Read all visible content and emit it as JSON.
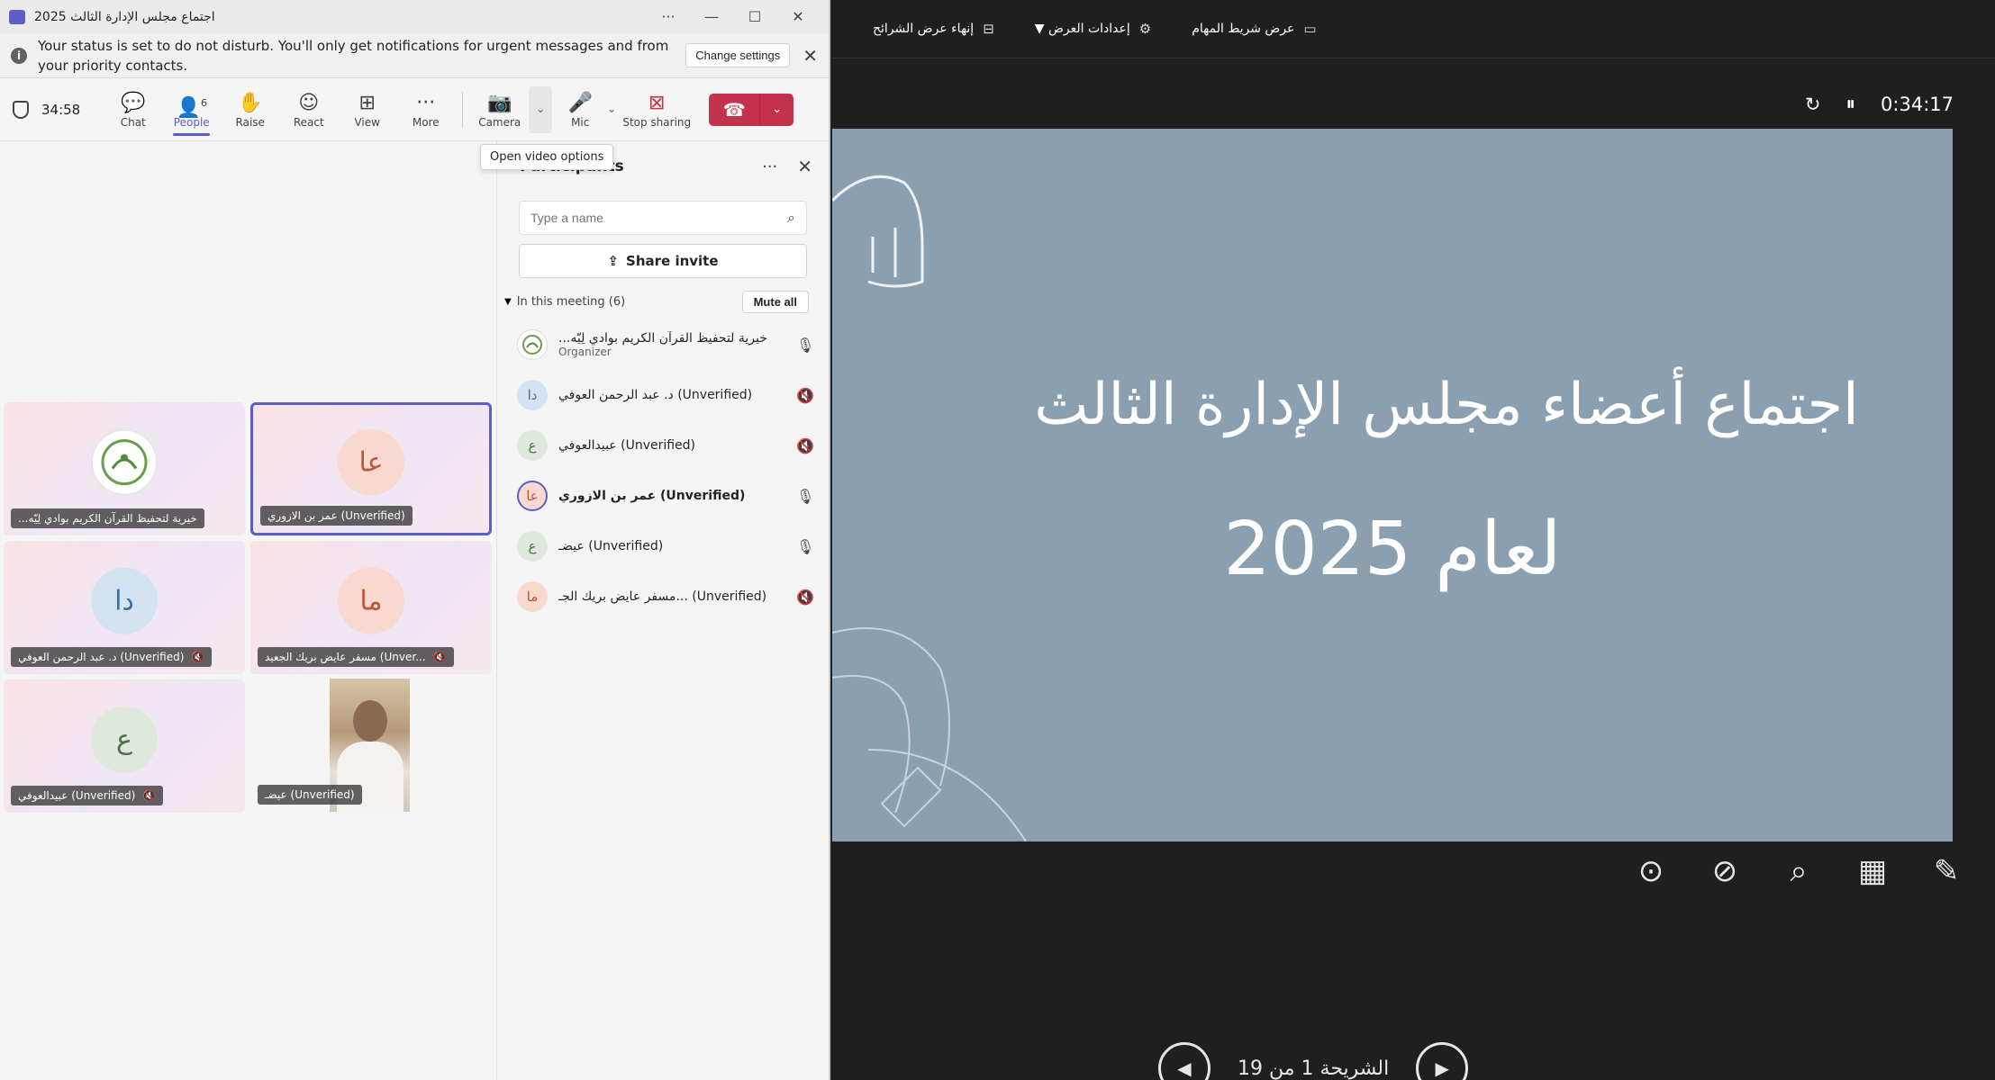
{
  "teams": {
    "title": "اجتماع مجلس الإدارة الثالث 2025",
    "window_controls": [
      "···",
      "—",
      "☐",
      "✕"
    ],
    "dnd": {
      "message": "Your status is set to do not disturb. You'll only get notifications for urgent messages and from your priority contacts.",
      "change_settings": "Change settings"
    },
    "toolbar": {
      "timer": "34:58",
      "chat": "Chat",
      "people": "People",
      "people_count": "6",
      "raise": "Raise",
      "react": "React",
      "view": "View",
      "more": "More",
      "camera": "Camera",
      "mic": "Mic",
      "stop_sharing": "Stop sharing"
    },
    "tooltip": "Open video options",
    "tiles": [
      {
        "initials": "",
        "name": "...خيرية لتحفيظ القرآن الكريم بوادي لِيّه",
        "muted": false
      },
      {
        "initials": "عا",
        "name": "عمر بن الازوري (Unverified)",
        "muted": false
      },
      {
        "initials": "دا",
        "name": "د. عبد الرحمن العوفي (Unverified)",
        "muted": true
      },
      {
        "initials": "ما",
        "name": "مسفر عايض بريك الجعيد (Unver...",
        "muted": true
      },
      {
        "initials": "ع",
        "name": "عبيدالعوفي (Unverified)",
        "muted": true
      },
      {
        "initials": "",
        "name": "عيضـ (Unverified)",
        "muted": false
      }
    ],
    "panel": {
      "title": "Participants",
      "search_placeholder": "Type a name",
      "share_invite": "Share invite",
      "in_meeting": "In this meeting (6)",
      "mute_all": "Mute all",
      "participants": [
        {
          "initials": "",
          "name": "...خيرية لتحفيظ القرآن الكريم بوادي لِيّه",
          "role": "Organizer",
          "muted": false
        },
        {
          "initials": "دا",
          "name": "د. عبد الرحمن العوفي (Unverified)",
          "role": "",
          "muted": true
        },
        {
          "initials": "ع",
          "name": "عبيدالعوفي (Unverified)",
          "role": "",
          "muted": true
        },
        {
          "initials": "عا",
          "name": "عمر بن الازوري (Unverified)",
          "role": "",
          "muted": false
        },
        {
          "initials": "ع",
          "name": "عيضـ (Unverified)",
          "role": "",
          "muted": false
        },
        {
          "initials": "ما",
          "name": "مسفر عايض بريك الجـ... (Unverified)",
          "role": "",
          "muted": true
        }
      ]
    }
  },
  "presenter": {
    "top_menu": [
      "عرض شريط المهام",
      "إعدادات العرض ▼",
      "إنهاء عرض الشرائح"
    ],
    "timer": "0:34:17",
    "slide": {
      "title_line1": "اجتماع أعضاء مجلس الإدارة الثالث",
      "title_line2": "لعام  2025"
    },
    "slide_counter": "الشريحة 1 من 19"
  },
  "colors": {
    "accent": "#5b5fc7",
    "leave_red": "#c4314b",
    "slide_bg": "#8aa0b1"
  }
}
